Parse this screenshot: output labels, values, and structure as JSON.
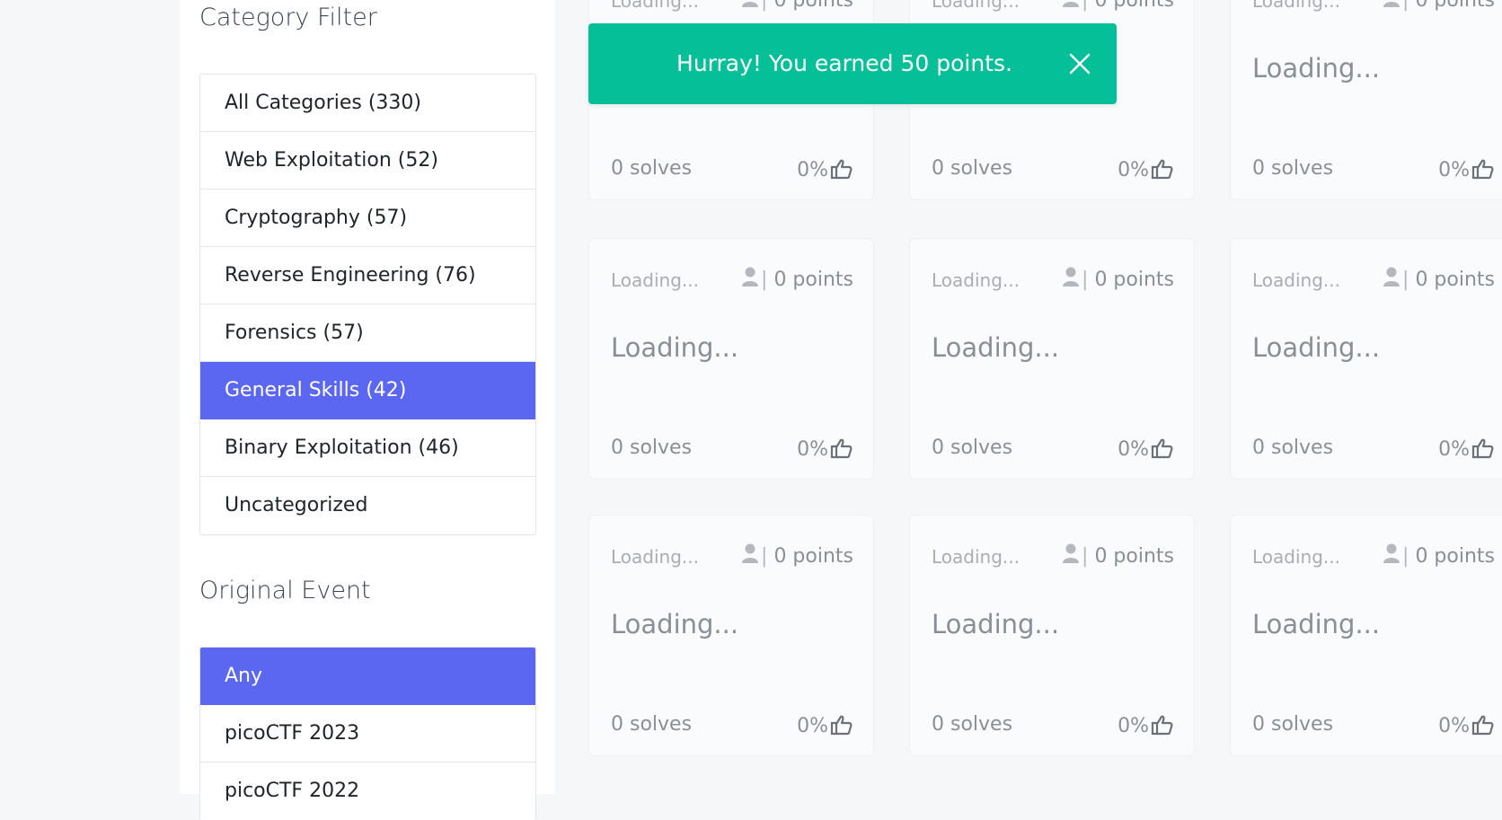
{
  "sidebar": {
    "category_title": "Category Filter",
    "categories": [
      {
        "label": "All Categories  (330)",
        "active": false
      },
      {
        "label": "Web Exploitation (52)",
        "active": false
      },
      {
        "label": "Cryptography (57)",
        "active": false
      },
      {
        "label": "Reverse Engineering (76)",
        "active": false
      },
      {
        "label": "Forensics (57)",
        "active": false
      },
      {
        "label": "General Skills (42)",
        "active": true
      },
      {
        "label": "Binary Exploitation (46)",
        "active": false
      },
      {
        "label": "Uncategorized",
        "active": false
      }
    ],
    "event_title": "Original Event",
    "events": [
      {
        "label": "Any",
        "active": true
      },
      {
        "label": "picoCTF 2023",
        "active": false
      },
      {
        "label": "picoCTF 2022",
        "active": false
      }
    ]
  },
  "toast": {
    "message": "Hurray! You earned 50 points.",
    "close_icon": "close-icon"
  },
  "cards": {
    "category": "Loading...",
    "points": "0 points",
    "title": "Loading...",
    "solves": "0 solves",
    "like_percent": "0%",
    "user_icon": "user-icon",
    "like_icon": "thumbs-up-icon"
  },
  "colors": {
    "accent": "#5b67f1",
    "toast": "#05bf98",
    "background": "#f6f7f9"
  }
}
